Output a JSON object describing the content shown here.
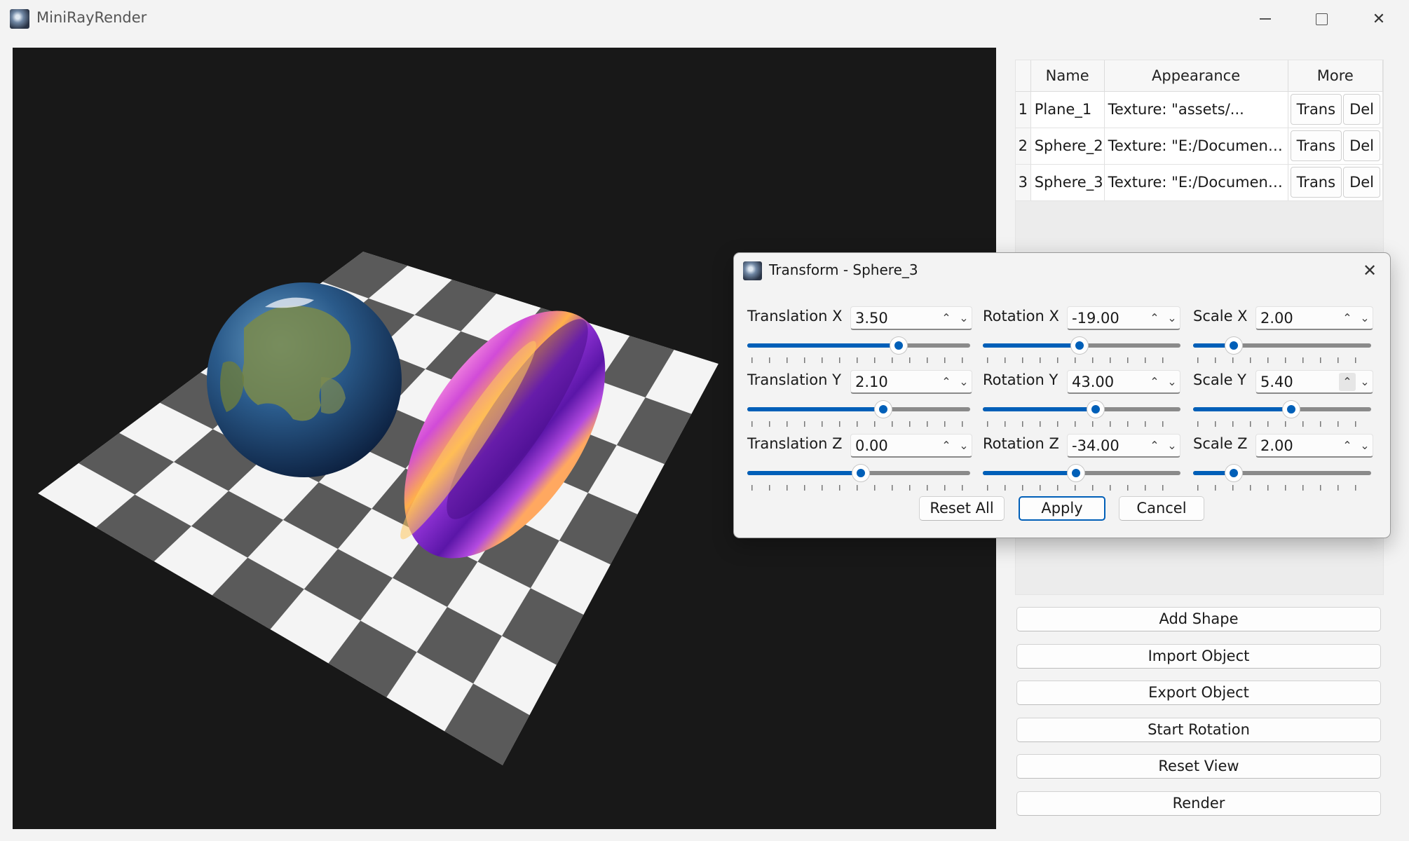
{
  "app": {
    "title": "MiniRayRender"
  },
  "colors": {
    "accent": "#005fb8",
    "viewport_bg": "#181818"
  },
  "table": {
    "headers": [
      "Name",
      "Appearance",
      "More"
    ],
    "rows": [
      {
        "index": "1",
        "name": "Plane_1",
        "appearance": "Texture: \"assets/...",
        "trans": "Trans",
        "del": "Del"
      },
      {
        "index": "2",
        "name": "Sphere_2",
        "appearance": "Texture: \"E:/Document...",
        "trans": "Trans",
        "del": "Del"
      },
      {
        "index": "3",
        "name": "Sphere_3",
        "appearance": "Texture: \"E:/Document...",
        "trans": "Trans",
        "del": "Del"
      }
    ]
  },
  "side_buttons": {
    "add_shape": "Add Shape",
    "import_object": "Import Object",
    "export_object": "Export Object",
    "start_rotation": "Start Rotation",
    "reset_view": "Reset View",
    "render": "Render"
  },
  "dialog": {
    "title": "Transform - Sphere_3",
    "fields": {
      "translation_x": {
        "label": "Translation X",
        "value": "3.50",
        "slider": 0.68
      },
      "translation_y": {
        "label": "Translation Y",
        "value": "2.10",
        "slider": 0.61
      },
      "translation_z": {
        "label": "Translation Z",
        "value": "0.00",
        "slider": 0.51
      },
      "rotation_x": {
        "label": "Rotation X",
        "value": "-19.00",
        "slider": 0.49
      },
      "rotation_y": {
        "label": "Rotation Y",
        "value": "43.00",
        "slider": 0.57
      },
      "rotation_z": {
        "label": "Rotation Z",
        "value": "-34.00",
        "slider": 0.47
      },
      "scale_x": {
        "label": "Scale X",
        "value": "2.00",
        "slider": 0.23
      },
      "scale_y": {
        "label": "Scale Y",
        "value": "5.40",
        "slider": 0.55
      },
      "scale_z": {
        "label": "Scale Z",
        "value": "2.00",
        "slider": 0.23
      }
    },
    "buttons": {
      "reset_all": "Reset All",
      "apply": "Apply",
      "cancel": "Cancel"
    }
  }
}
